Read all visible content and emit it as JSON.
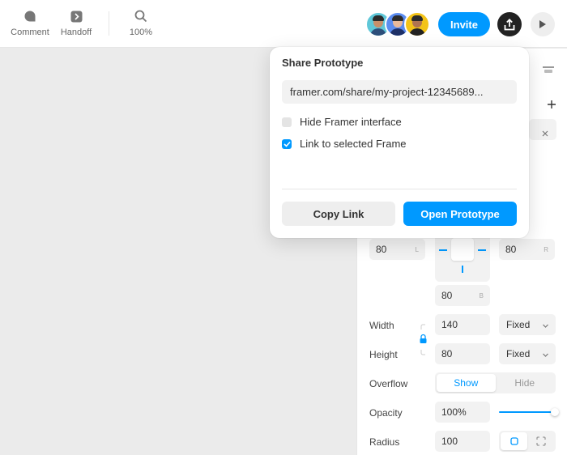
{
  "toolbar": {
    "comment_label": "Comment",
    "handoff_label": "Handoff",
    "zoom_label": "100%",
    "invite_label": "Invite",
    "icons": [
      "comment-icon",
      "handoff-icon",
      "search-icon",
      "share-icon",
      "play-icon"
    ]
  },
  "share_popover": {
    "title": "Share Prototype",
    "url": "framer.com/share/my-project-12345689...",
    "hide_interface_label": "Hide Framer interface",
    "hide_interface_checked": false,
    "link_frame_label": "Link to selected Frame",
    "link_frame_checked": true,
    "copy_link_label": "Copy Link",
    "open_prototype_label": "Open Prototype"
  },
  "panel": {
    "padding": {
      "left": "80",
      "left_hint": "L",
      "right": "80",
      "right_hint": "R",
      "bottom": "80",
      "bottom_hint": "B"
    },
    "width": {
      "label": "Width",
      "value": "140",
      "mode": "Fixed"
    },
    "height": {
      "label": "Height",
      "value": "80",
      "mode": "Fixed"
    },
    "overflow": {
      "label": "Overflow",
      "options": [
        "Show",
        "Hide"
      ],
      "selected": "Show"
    },
    "opacity": {
      "label": "Opacity",
      "value": "100%"
    },
    "radius": {
      "label": "Radius",
      "value": "100"
    }
  },
  "colors": {
    "accent": "#0099ff",
    "dark_button": "#222222"
  }
}
